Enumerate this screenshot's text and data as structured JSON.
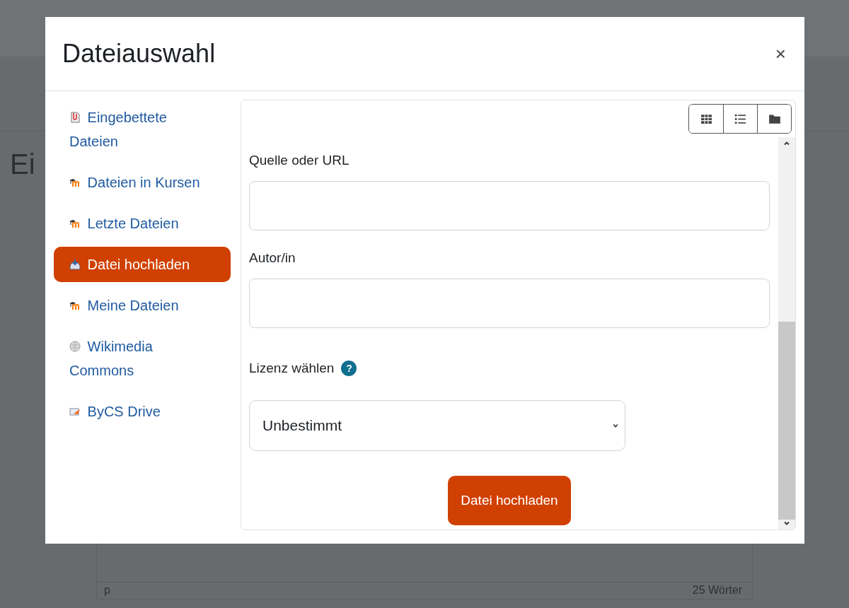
{
  "background_page": {
    "heading": "Ei",
    "editor_footer": {
      "path": "p",
      "word_count": "25 Wörter"
    }
  },
  "dialog": {
    "title": "Dateiauswahl",
    "close": "×",
    "sidebar": {
      "items": [
        {
          "kind": "embedded",
          "label": "Eingebettete Dateien",
          "selected": false
        },
        {
          "kind": "moodle",
          "label": "Dateien in Kursen",
          "selected": false
        },
        {
          "kind": "moodle",
          "label": "Letzte Dateien",
          "selected": false
        },
        {
          "kind": "upload",
          "label": "Datei hochladen",
          "selected": true
        },
        {
          "kind": "moodle",
          "label": "Meine Dateien",
          "selected": false
        },
        {
          "kind": "wiki",
          "label": "Wikimedia Commons",
          "selected": false
        },
        {
          "kind": "drive",
          "label": "ByCS Drive",
          "selected": false
        }
      ]
    },
    "view_buttons": [
      {
        "kind": "grid",
        "selected": false
      },
      {
        "kind": "list",
        "selected": false
      },
      {
        "kind": "folder",
        "selected": false
      }
    ],
    "form": {
      "source_label": "Quelle oder URL",
      "author_label": "Autor/in",
      "license_label": "Lizenz wählen",
      "license_help": "?",
      "license_value": "Unbestimmt",
      "submit": "Datei hochladen"
    }
  }
}
